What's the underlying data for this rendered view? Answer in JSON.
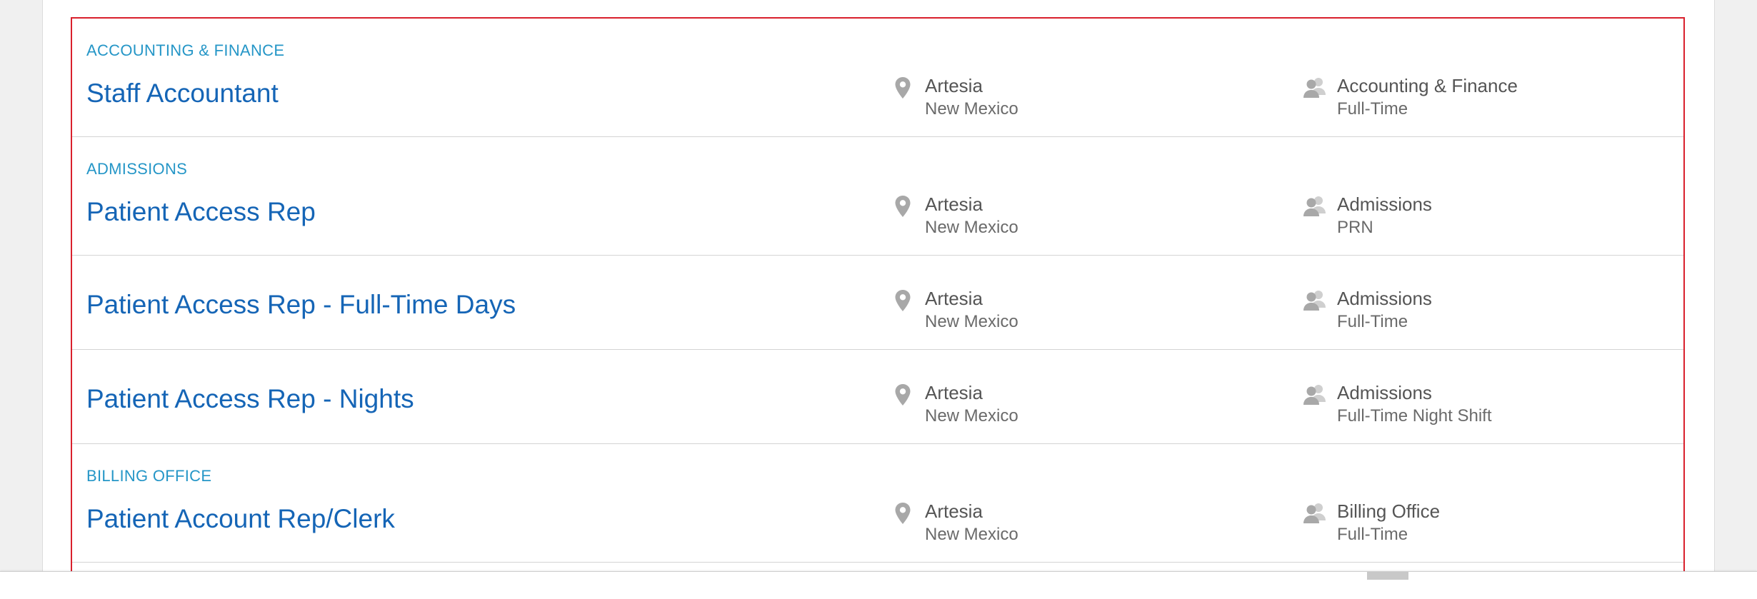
{
  "jobs": [
    {
      "category": "ACCOUNTING & FINANCE",
      "title": "Staff Accountant",
      "city": "Artesia",
      "state": "New Mexico",
      "department": "Accounting & Finance",
      "schedule": "Full-Time"
    },
    {
      "category": "ADMISSIONS",
      "title": "Patient Access Rep",
      "city": "Artesia",
      "state": "New Mexico",
      "department": "Admissions",
      "schedule": "PRN"
    },
    {
      "category": "",
      "title": "Patient Access Rep - Full-Time Days",
      "city": "Artesia",
      "state": "New Mexico",
      "department": "Admissions",
      "schedule": "Full-Time"
    },
    {
      "category": "",
      "title": "Patient Access Rep - Nights",
      "city": "Artesia",
      "state": "New Mexico",
      "department": "Admissions",
      "schedule": "Full-Time Night Shift"
    },
    {
      "category": "BILLING OFFICE",
      "title": "Patient Account Rep/Clerk",
      "city": "Artesia",
      "state": "New Mexico",
      "department": "Billing Office",
      "schedule": "Full-Time"
    }
  ],
  "icons": {
    "location": "map-pin-icon",
    "department": "people-icon"
  },
  "colors": {
    "category": "#2596c7",
    "title_link": "#1565b6",
    "frame_border": "#d9202c",
    "icon_gray": "#a8a8a8"
  }
}
